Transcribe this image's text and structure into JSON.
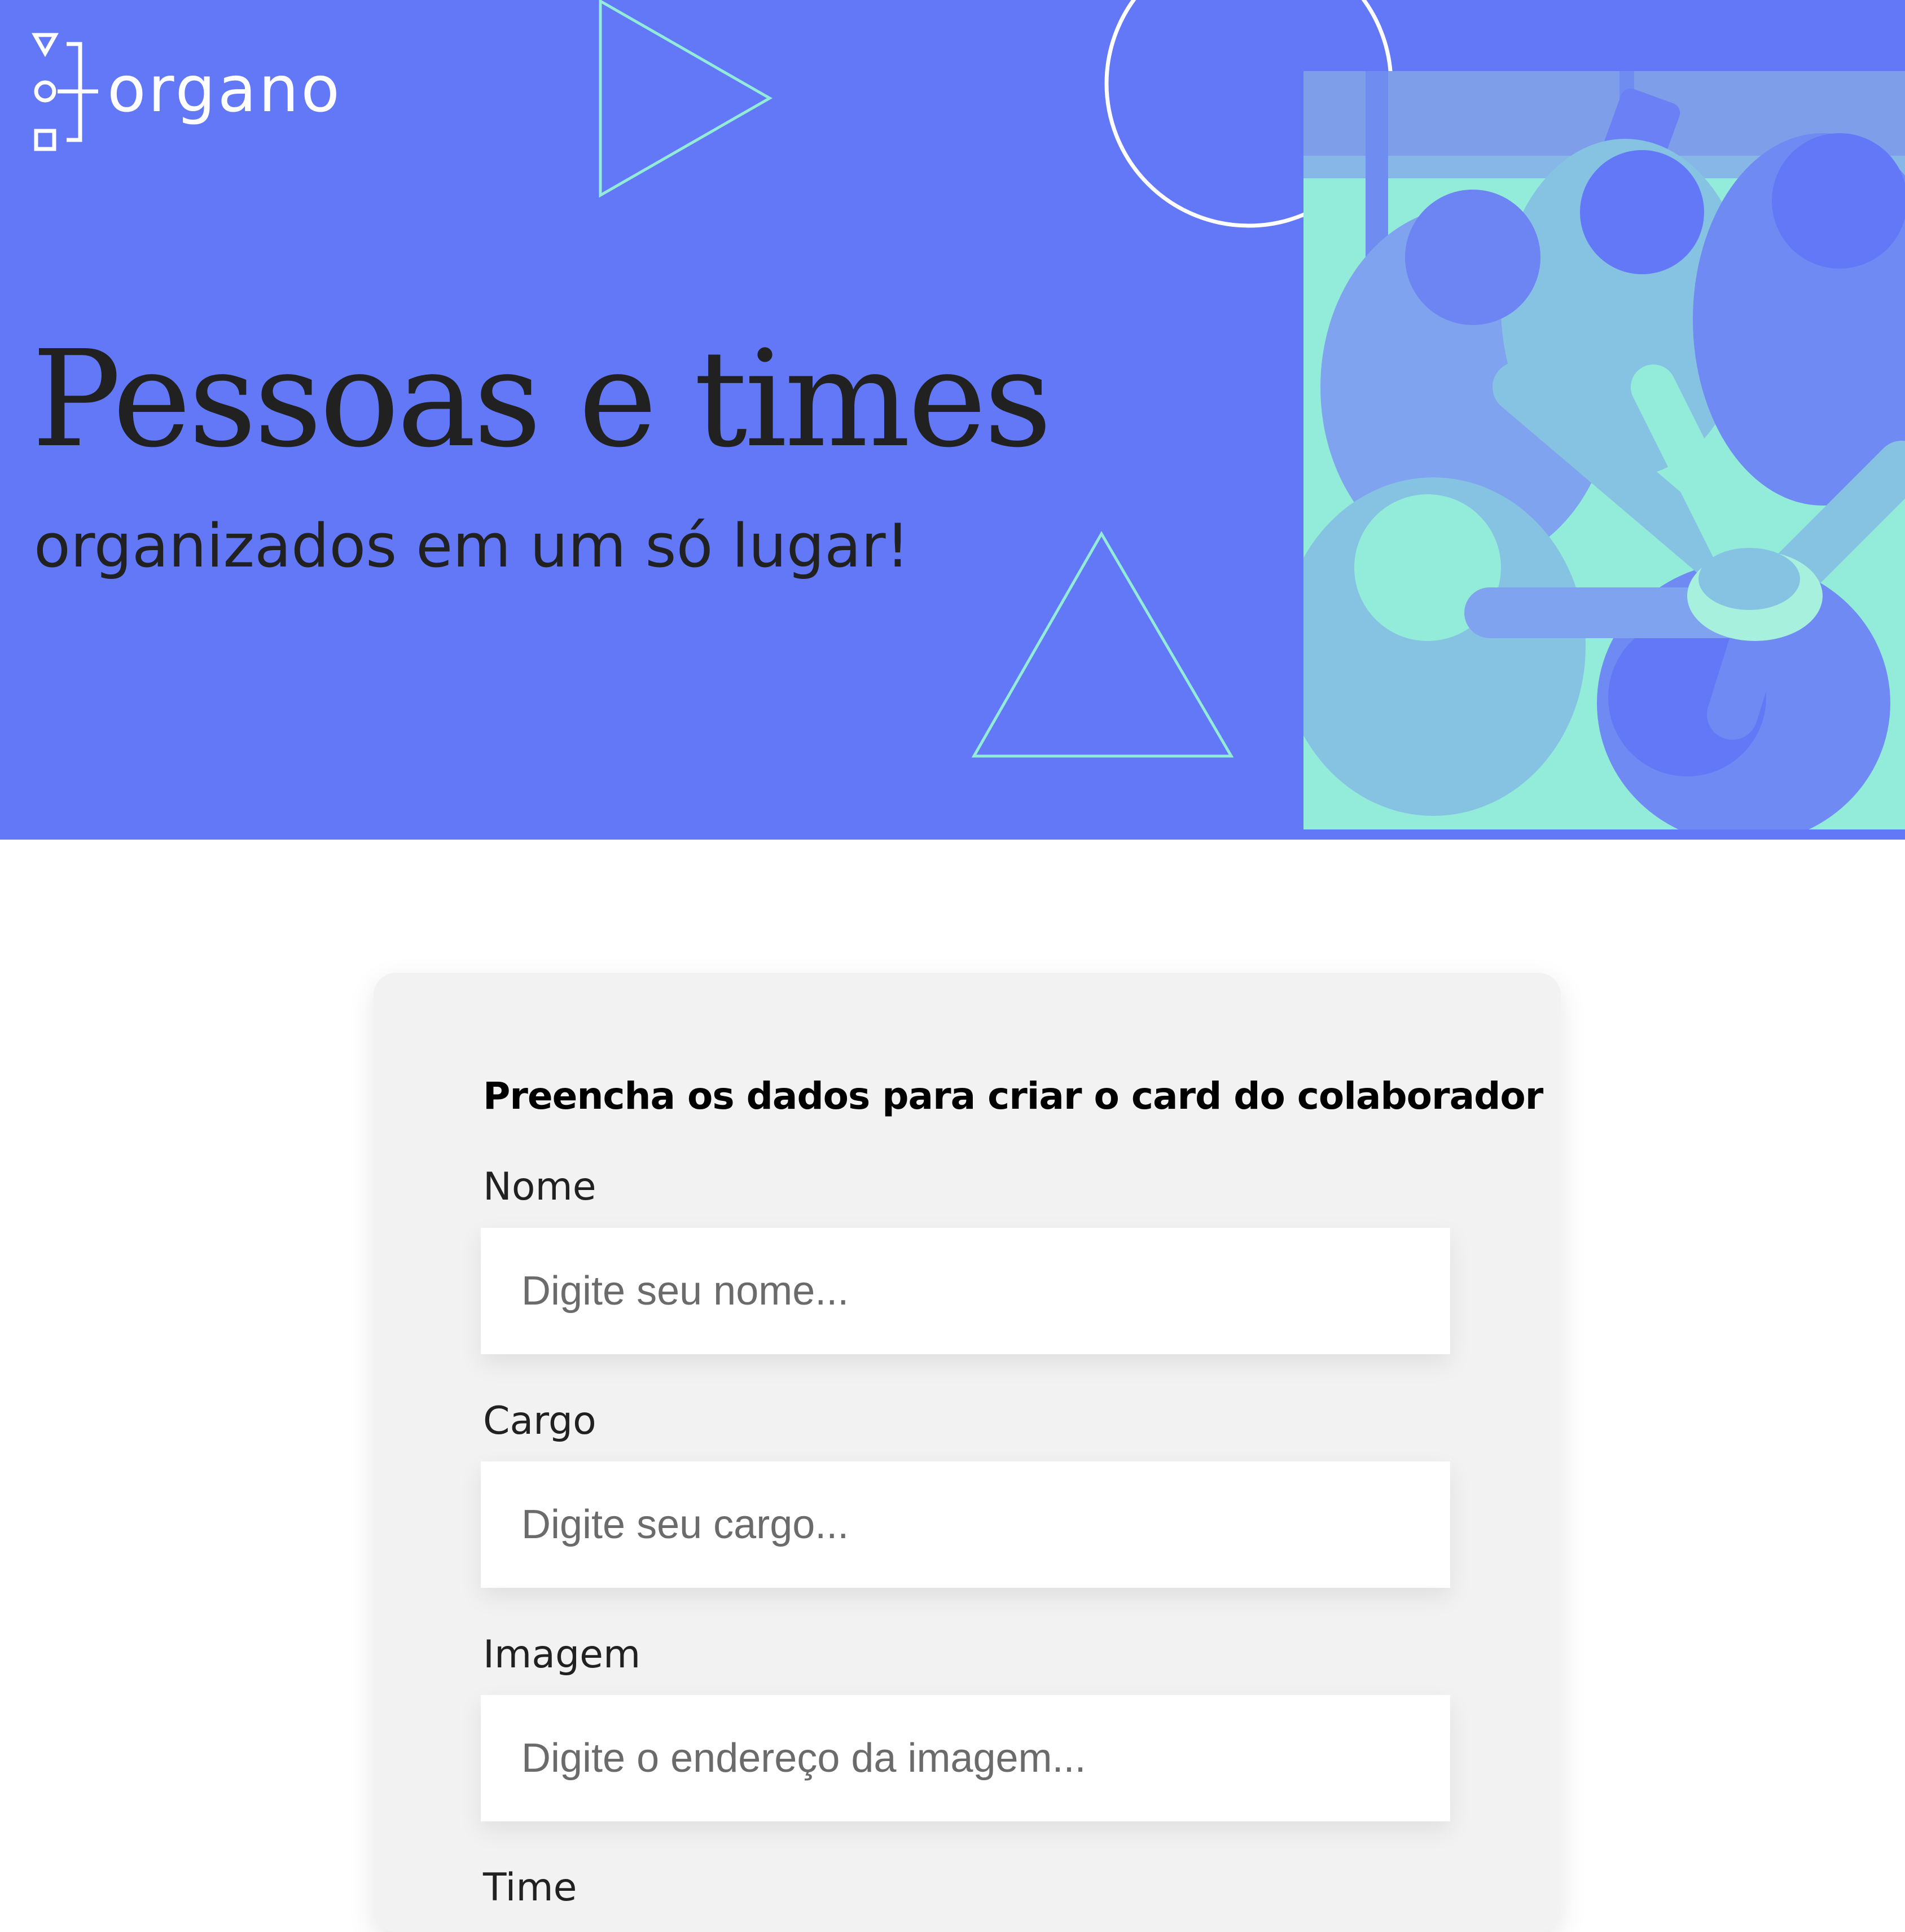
{
  "brand": {
    "name": "organo"
  },
  "hero": {
    "title": "Pessoas e times",
    "subtitle": "organizados em um só lugar!",
    "image": "team-photo"
  },
  "colors": {
    "banner": "#6278f7",
    "accent": "#93ecd9",
    "text_dark": "#212121",
    "card_bg": "#f2f2f2"
  },
  "form": {
    "heading": "Preencha os dados para criar o card do colaborador",
    "fields": [
      {
        "label": "Nome",
        "placeholder": "Digite seu nome..."
      },
      {
        "label": "Cargo",
        "placeholder": "Digite seu cargo..."
      },
      {
        "label": "Imagem",
        "placeholder": "Digite o endereço da imagem..."
      },
      {
        "label": "Time"
      }
    ]
  }
}
